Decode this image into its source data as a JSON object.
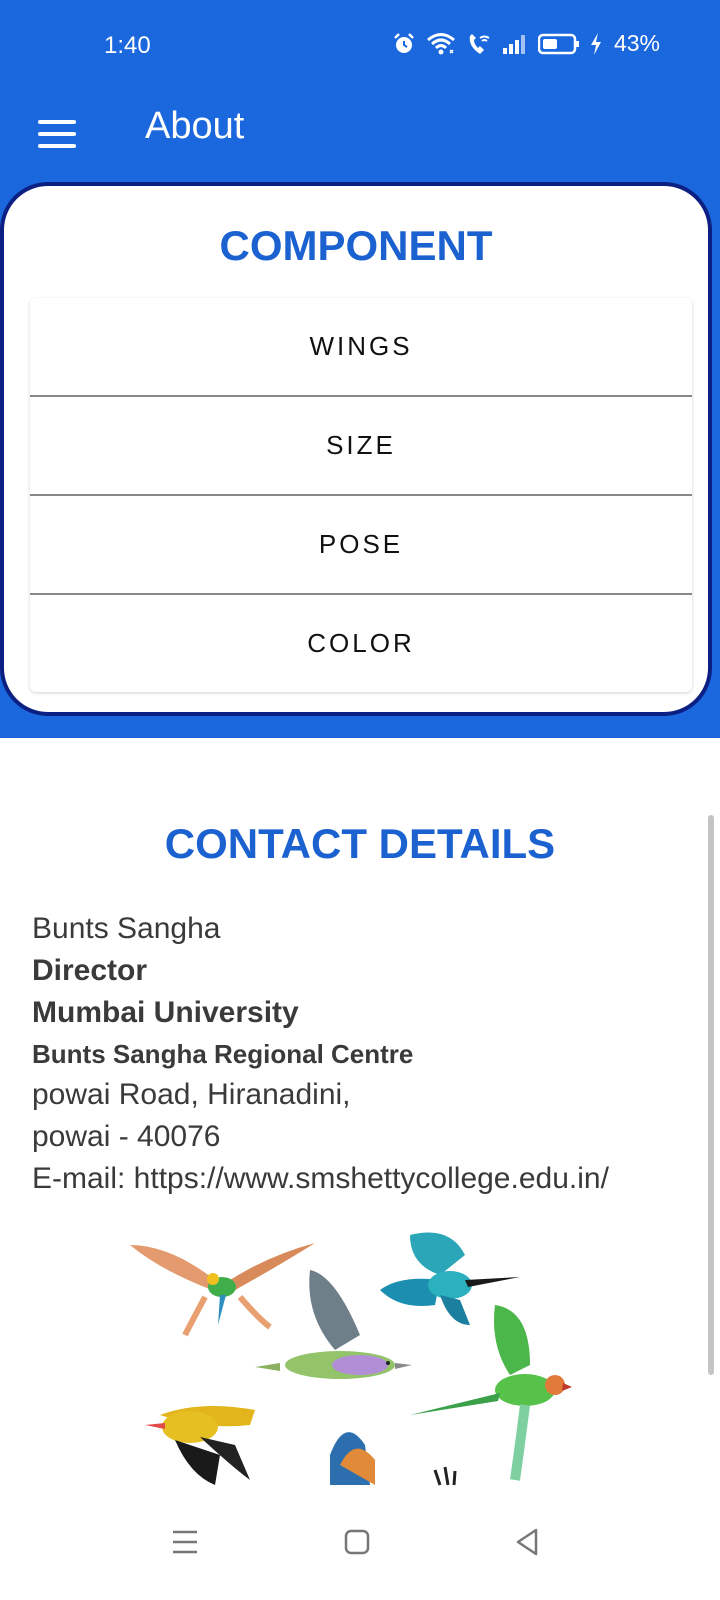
{
  "status_bar": {
    "time": "1:40",
    "battery_percent": "43%",
    "icons": [
      "alarm-icon",
      "wifi-icon",
      "wifi-call-icon",
      "signal-icon",
      "battery-icon",
      "charging-icon"
    ]
  },
  "app_bar": {
    "title": "About",
    "menu_icon": "hamburger-menu-icon",
    "background": "#1a67de"
  },
  "component_section": {
    "title": "COMPONENT",
    "items": [
      {
        "label": "WINGS"
      },
      {
        "label": "SIZE"
      },
      {
        "label": "POSE"
      },
      {
        "label": "COLOR"
      }
    ]
  },
  "contact_section": {
    "title": "CONTACT DETAILS",
    "lines": {
      "name": "Bunts Sangha",
      "role": "Director",
      "university": "Mumbai University",
      "centre": "Bunts Sangha Regional Centre",
      "address1": "powai Road, Hiranadini,",
      "address2": "powai - 40076",
      "email": "E-mail: https://www.smshettycollege.edu.in/"
    }
  },
  "illustration": {
    "icon": "birds-illustration"
  },
  "nav_bar": {
    "icons": [
      "recent-apps-icon",
      "home-icon",
      "back-icon"
    ]
  },
  "colors": {
    "accent": "#1a67de",
    "title_blue": "#1b62d0",
    "card_border": "#0c1f82"
  }
}
